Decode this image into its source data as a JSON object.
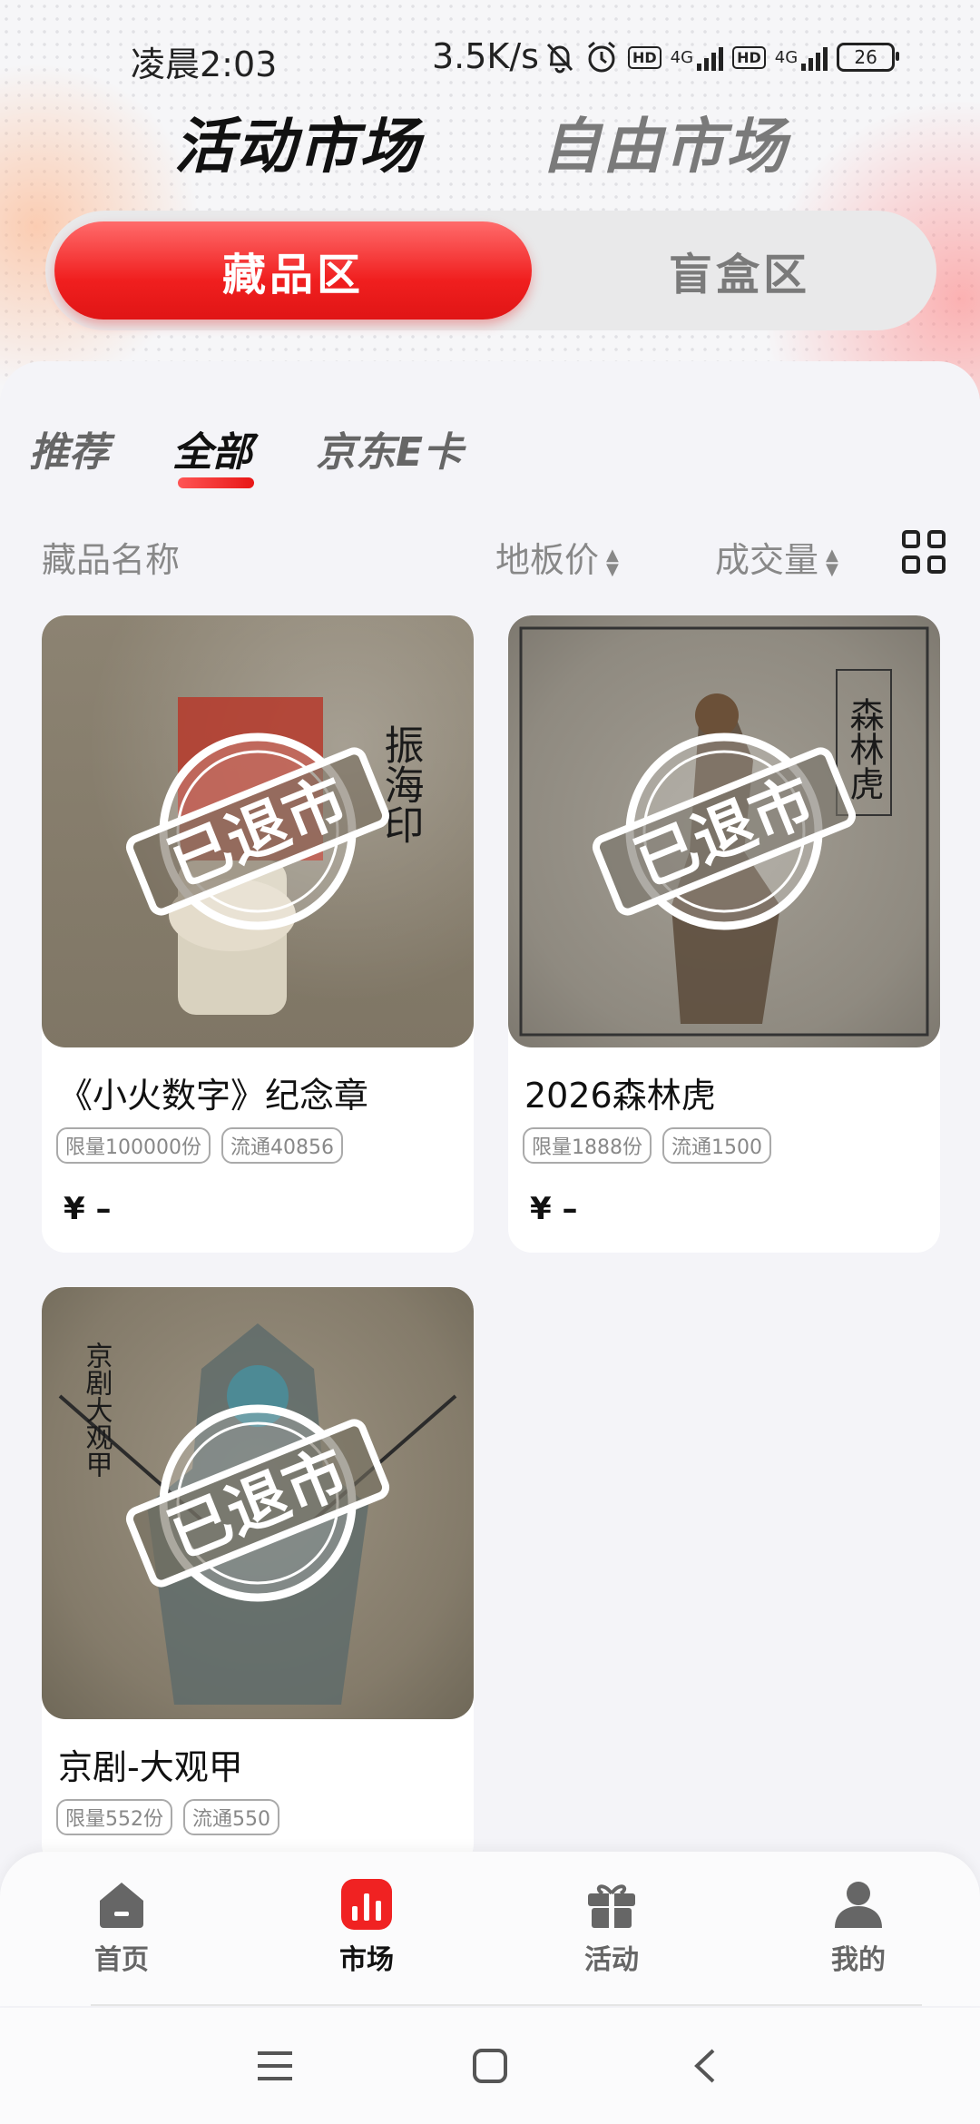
{
  "status_bar": {
    "time": "凌晨2:03",
    "speed": "3.5K/s",
    "battery": "26",
    "network1": "4G",
    "network2": "4G",
    "hd": "HD"
  },
  "market_tabs": [
    {
      "label": "活动市场",
      "active": true
    },
    {
      "label": "自由市场",
      "active": false
    }
  ],
  "segment": {
    "active": "藏品区",
    "inactive": "盲盒区"
  },
  "categories": [
    {
      "label": "推荐"
    },
    {
      "label": "全部",
      "active": true
    },
    {
      "label": "京东E卡"
    }
  ],
  "sort": {
    "name": "藏品名称",
    "floor_price": "地板价",
    "volume": "成交量"
  },
  "stamp_text": "已退市",
  "items": [
    {
      "title": "《小火数字》纪念章",
      "tags": [
        "限量100000份",
        "流通40856"
      ],
      "price": "¥ –",
      "image_text": "振海印"
    },
    {
      "title": "2026森林虎",
      "tags": [
        "限量1888份",
        "流通1500"
      ],
      "price": "¥ –",
      "image_text": "森林虎"
    },
    {
      "title": "京剧-大观甲",
      "tags": [
        "限量552份",
        "流通550"
      ],
      "price": "",
      "image_text": "京剧大观甲"
    }
  ],
  "nav": [
    {
      "label": "首页",
      "icon": "home-icon"
    },
    {
      "label": "市场",
      "icon": "market-icon",
      "active": true
    },
    {
      "label": "活动",
      "icon": "gift-icon"
    },
    {
      "label": "我的",
      "icon": "user-icon"
    }
  ],
  "colors": {
    "accent": "#f02222",
    "inactive_text": "#7a7a7a"
  }
}
